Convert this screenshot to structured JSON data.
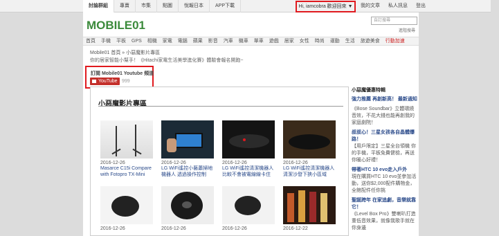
{
  "topbar": {
    "links": [
      "討論群組",
      "專賣",
      "市集",
      "點圖",
      "悅報日本",
      "APP下載"
    ],
    "user_greeting": "Hi, iamcobra 歡迎回來",
    "right_links": [
      "我的文章",
      "私人訊息",
      "登出"
    ]
  },
  "header": {
    "logo_text": "MOBILE01",
    "search_placeholder": "自訂搜尋",
    "advanced_search": "進階搜尋"
  },
  "nav": {
    "items": [
      "首頁",
      "手機",
      "平板",
      "GPS",
      "相機",
      "家電",
      "電腦",
      "蘋果",
      "影音",
      "汽車",
      "機車",
      "單車",
      "遊戲",
      "居家",
      "女性",
      "時尚",
      "運動",
      "生活",
      "旅遊美食",
      "行動加速"
    ]
  },
  "breadcrumb": "Mobile01 首頁 » 小惡魔影片專區",
  "promo": "你的居家智能小幫手！《Hitachi家電生活美學進化賽》體驗會報名開跑~",
  "youtube": {
    "title": "訂閱 Mobile01 Youtube 頻道",
    "button": "YouTube",
    "count": "999"
  },
  "content": {
    "title": "小惡魔影片專區",
    "videos": [
      {
        "date": "2016-12-26",
        "title": "Masarce C15i Compare with Fotopro TX-Mini"
      },
      {
        "date": "2016-12-26",
        "title": "LG WiFi遙控小藝蕭掃地機器人 透過操作控制"
      },
      {
        "date": "2016-12-26",
        "title": "LG WiFi遙控清潔機器人 比較不會被電線線卡住"
      },
      {
        "date": "2016-12-26",
        "title": "LG WiFi遙控清潔機器人 清潔沙發下狹小區域"
      },
      {
        "date": "2016-12-26",
        "title": ""
      },
      {
        "date": "2016-12-26",
        "title": ""
      },
      {
        "date": "2016-12-26",
        "title": ""
      },
      {
        "date": "2016-12-22",
        "title": ""
      }
    ]
  },
  "sidebar": {
    "heading": "小惡魔優惠特輯",
    "items": [
      {
        "title": "強力推薦 再創新高！ 最新通知",
        "desc": ""
      },
      {
        "title": "",
        "desc": "《Bose Soundbar》立體環繞音效，不花大錢也能再創我的家庭劇院！"
      },
      {
        "title": "叔叔心！三星女孩各自晶體爆路！",
        "desc": "【用戶限定】三星全台領機 你的手機，平板免費健檢，再送你暖心好禮！"
      },
      {
        "title": "帶著HTC 10 evo走入戶外",
        "desc": "現在購買HTC 10 evo並參加活動，送你$2,000配件購物金，全館配件任你挑"
      },
      {
        "title": "聖誕跨年 在家追劇，音樂就靠它！",
        "desc": "《Level Box Pro》雙喇叭打造重低音效果，就像我歌手就在你身邊"
      }
    ]
  },
  "colors": {
    "highlight_border": "#e0191e",
    "youtube_red": "#c4302b",
    "link_blue": "#2a4a8a",
    "logo_green": "#3b8a3b"
  }
}
